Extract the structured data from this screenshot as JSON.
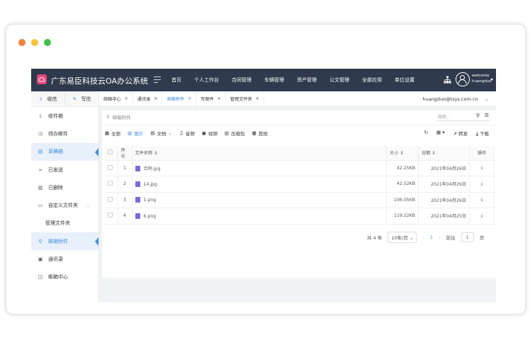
{
  "app": {
    "title": "广东易臣科技云OA办公系统"
  },
  "nav": [
    "首页",
    "个人工作台",
    "合同管理",
    "车辆管理",
    "资产管理",
    "公文管理",
    "全部应用",
    "单位设置"
  ],
  "user": {
    "greeting": "welcome",
    "name": "huangduo"
  },
  "sidebar": {
    "receive": "收信",
    "write": "写信",
    "items": [
      {
        "label": "收件箱",
        "icon": "download-icon"
      },
      {
        "label": "待办邮件",
        "icon": "clock-icon"
      },
      {
        "label": "草稿箱",
        "icon": "document-icon"
      },
      {
        "label": "已发送",
        "icon": "send-icon"
      },
      {
        "label": "已删除",
        "icon": "trash-icon"
      },
      {
        "label": "自定义文件夹",
        "icon": "folder-icon"
      },
      {
        "label": "管理文件夹",
        "icon": ""
      },
      {
        "label": "邮箱附件",
        "icon": "paperclip-icon"
      },
      {
        "label": "通讯录",
        "icon": "contacts-icon"
      },
      {
        "label": "邮箱中心",
        "icon": "mail-center-icon"
      }
    ]
  },
  "tabs": [
    "邮箱中心",
    "通讯录",
    "邮箱附件",
    "写邮件",
    "管理文件夹"
  ],
  "account": "huangduo@tsys.com.cn",
  "crumb": "邮箱附件",
  "search": {
    "placeholder": "搜索..."
  },
  "filters": [
    "全部",
    "图片",
    "文档",
    "音频",
    "视频",
    "压缩包",
    "其他"
  ],
  "tools": {
    "forward": "转发",
    "download": "下载"
  },
  "table": {
    "headers": {
      "index": "序号",
      "name": "文件名称",
      "size": "大小",
      "date": "日期",
      "action": "操作"
    },
    "rows": [
      {
        "index": "1",
        "name": "合同.jpg",
        "size": "42.25KB",
        "date": "2021年04月26日"
      },
      {
        "index": "2",
        "name": "14.jpg",
        "size": "42.52KB",
        "date": "2021年04月26日"
      },
      {
        "index": "3",
        "name": "1.png",
        "size": "106.05KB",
        "date": "2021年04月26日"
      },
      {
        "index": "4",
        "name": "6.png",
        "size": "119.22KB",
        "date": "2021年04月25日"
      }
    ]
  },
  "pager": {
    "total": "共 4 条",
    "per_page": "10条/页",
    "current": "1",
    "goto": "前往",
    "page_value": "1",
    "unit": "页"
  },
  "colors": {
    "topbar": "#2f3a4d",
    "accent": "#3f8ee0",
    "logo": "#e5487b"
  }
}
